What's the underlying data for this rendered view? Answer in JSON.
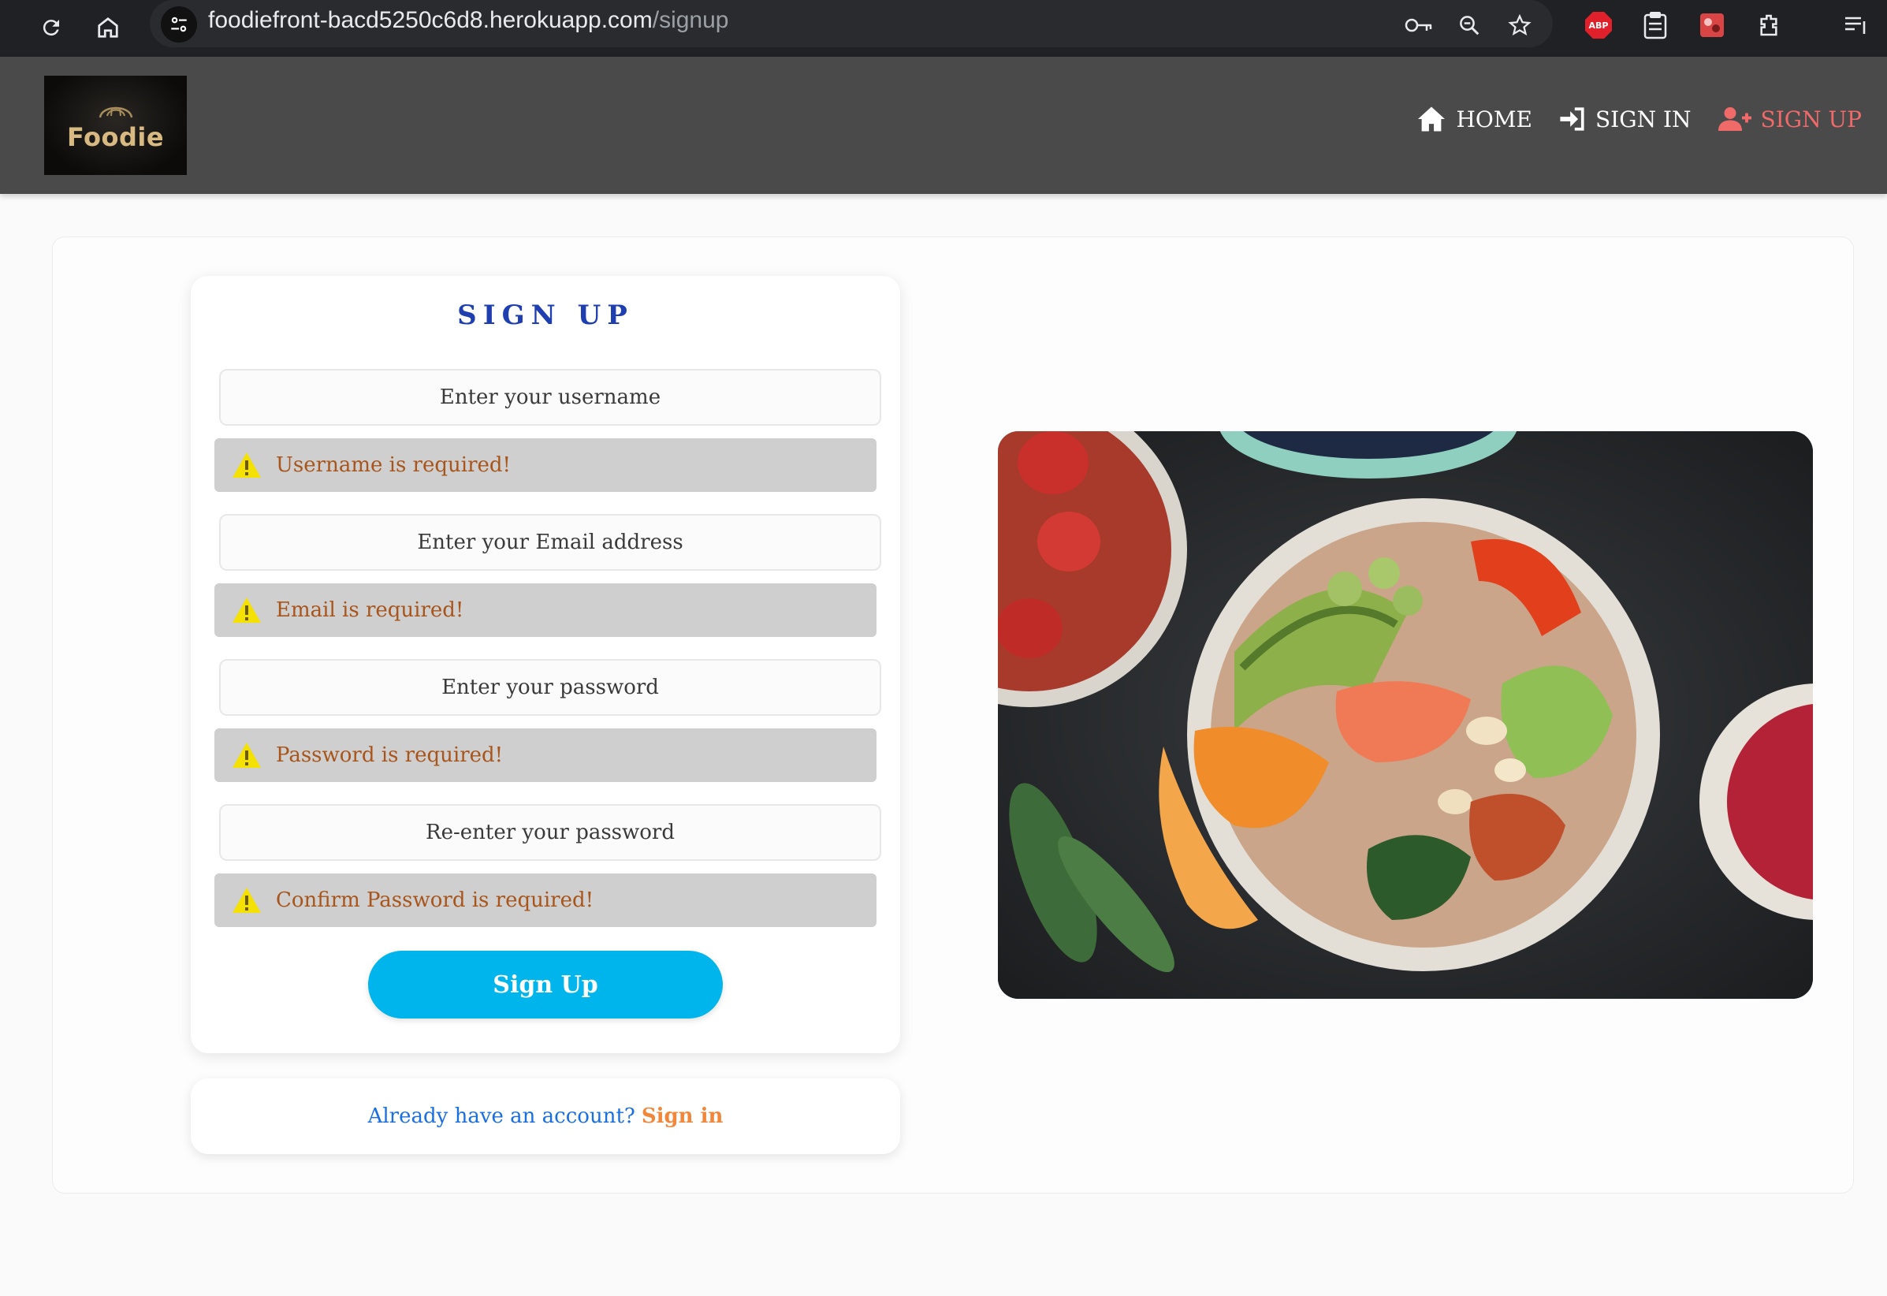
{
  "browser": {
    "url_host": "foodiefront-bacd5250c6d8.herokuapp.com",
    "url_path": "/signup"
  },
  "header": {
    "logo_text": "Foodie",
    "nav": [
      {
        "label": "HOME",
        "icon": "home-icon"
      },
      {
        "label": "SIGN IN",
        "icon": "sign-in-icon"
      },
      {
        "label": "SIGN UP",
        "icon": "user-plus-icon",
        "active": true
      }
    ]
  },
  "form": {
    "title": "SIGN UP",
    "fields": [
      {
        "placeholder": "Enter your username",
        "error": "Username is required!"
      },
      {
        "placeholder": "Enter your Email address",
        "error": "Email is required!"
      },
      {
        "placeholder": "Enter your password",
        "error": "Password is required!"
      },
      {
        "placeholder": "Re-enter your password",
        "error": "Confirm Password is required!"
      }
    ],
    "submit_label": "Sign Up"
  },
  "signin_prompt": {
    "question": "Already have an account?",
    "link": "Sign in"
  },
  "colors": {
    "accent": "#00b5ec",
    "title": "#1f3fb1",
    "nav_active": "#f06a6a",
    "error_text": "#a8551c",
    "warning_icon": "#f5e100"
  }
}
